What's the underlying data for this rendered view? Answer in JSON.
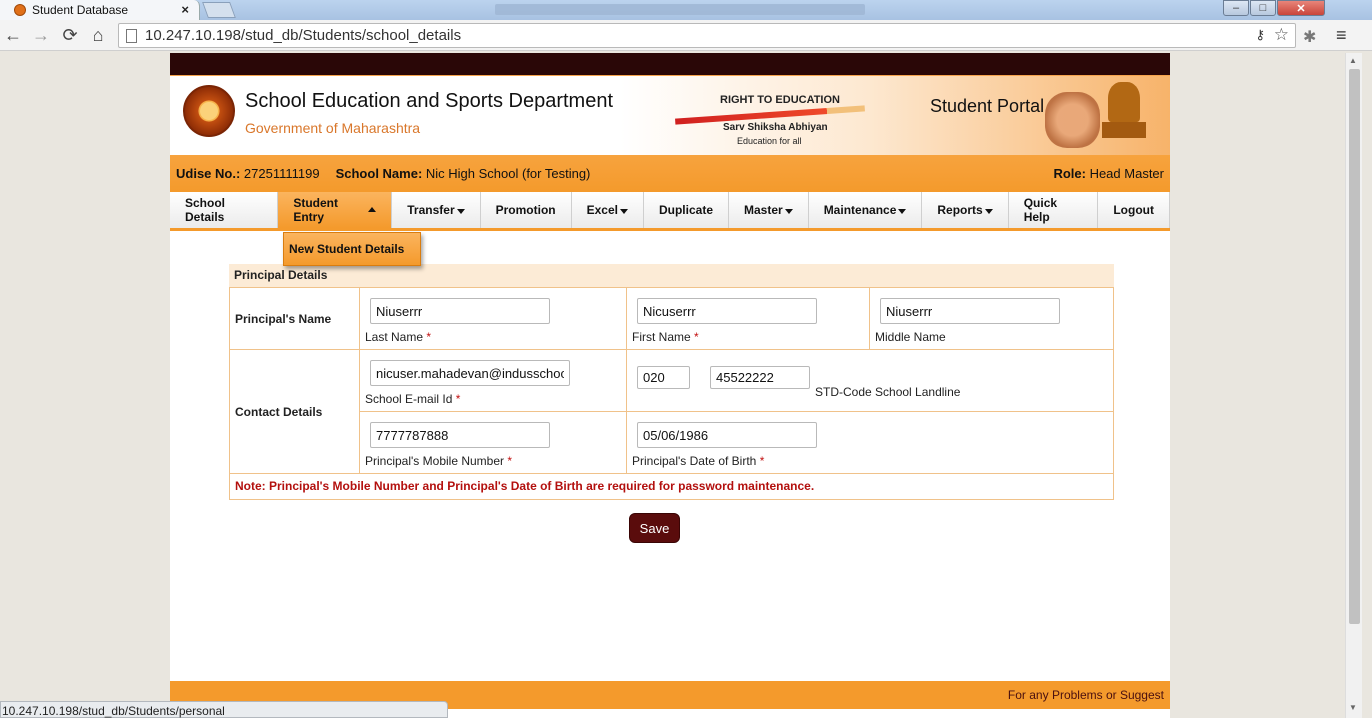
{
  "browser": {
    "tab_title": "Student Database",
    "tab_close": "×",
    "url": "10.247.10.198/stud_db/Students/school_details",
    "status_url": "10.247.10.198/stud_db/Students/personal",
    "win_min": "–",
    "win_max": "□",
    "win_close": "✕",
    "icons": {
      "back": "←",
      "forward": "→",
      "reload": "⟳",
      "home": "⌂",
      "key": "⚷",
      "star": "☆",
      "extension": "✱",
      "menu": "≡"
    }
  },
  "header": {
    "title": "School Education and Sports Department",
    "subtitle": "Government of Maharashtra",
    "rte_title": "RIGHT TO EDUCATION",
    "rte_ssa": "Sarv Shiksha Abhiyan",
    "rte_tag": "Education for all",
    "portal": "Student Portal"
  },
  "info": {
    "udise_label": "Udise No.:",
    "udise_value": " 27251111199",
    "school_label": "School Name:",
    "school_value": " Nic High School (for Testing)",
    "role_label": "Role:",
    "role_value": " Head Master"
  },
  "menu": {
    "items": [
      {
        "label": "School Details"
      },
      {
        "label": "Student Entry"
      },
      {
        "label": "Transfer"
      },
      {
        "label": "Promotion"
      },
      {
        "label": "Excel"
      },
      {
        "label": "Duplicate"
      },
      {
        "label": "Master"
      },
      {
        "label": "Maintenance"
      },
      {
        "label": "Reports"
      },
      {
        "label": "Quick Help"
      },
      {
        "label": "Logout"
      }
    ],
    "dropdown_item": "New Student Details"
  },
  "form": {
    "section_title": "Principal Details",
    "principal_name_label": "Principal's Name",
    "last_name": "Niuserrr",
    "last_name_label": "Last Name",
    "first_name": "Nicuserrr",
    "first_name_label": "First Name",
    "middle_name": "Niuserrr",
    "middle_name_label": "Middle Name",
    "contact_label": "Contact Details",
    "email": "nicuser.mahadevan@indusschool",
    "email_label": "School E-mail Id",
    "std_code": "020",
    "landline": "45522222",
    "landline_label": "STD-Code School Landline",
    "mobile": "7777787888",
    "mobile_label": "Principal's Mobile Number",
    "dob": "05/06/1986",
    "dob_label": "Principal's Date of Birth",
    "required_mark": "*",
    "note": "Note: Principal's Mobile Number and Principal's Date of Birth are required for password maintenance.",
    "save_label": "Save"
  },
  "footer": {
    "text": "For any Problems or Suggest"
  },
  "colors": {
    "accent_orange": "#f49a2c",
    "dark_maroon": "#2a0707",
    "save_button": "#5a0c0c",
    "note_red": "#b3100e"
  }
}
